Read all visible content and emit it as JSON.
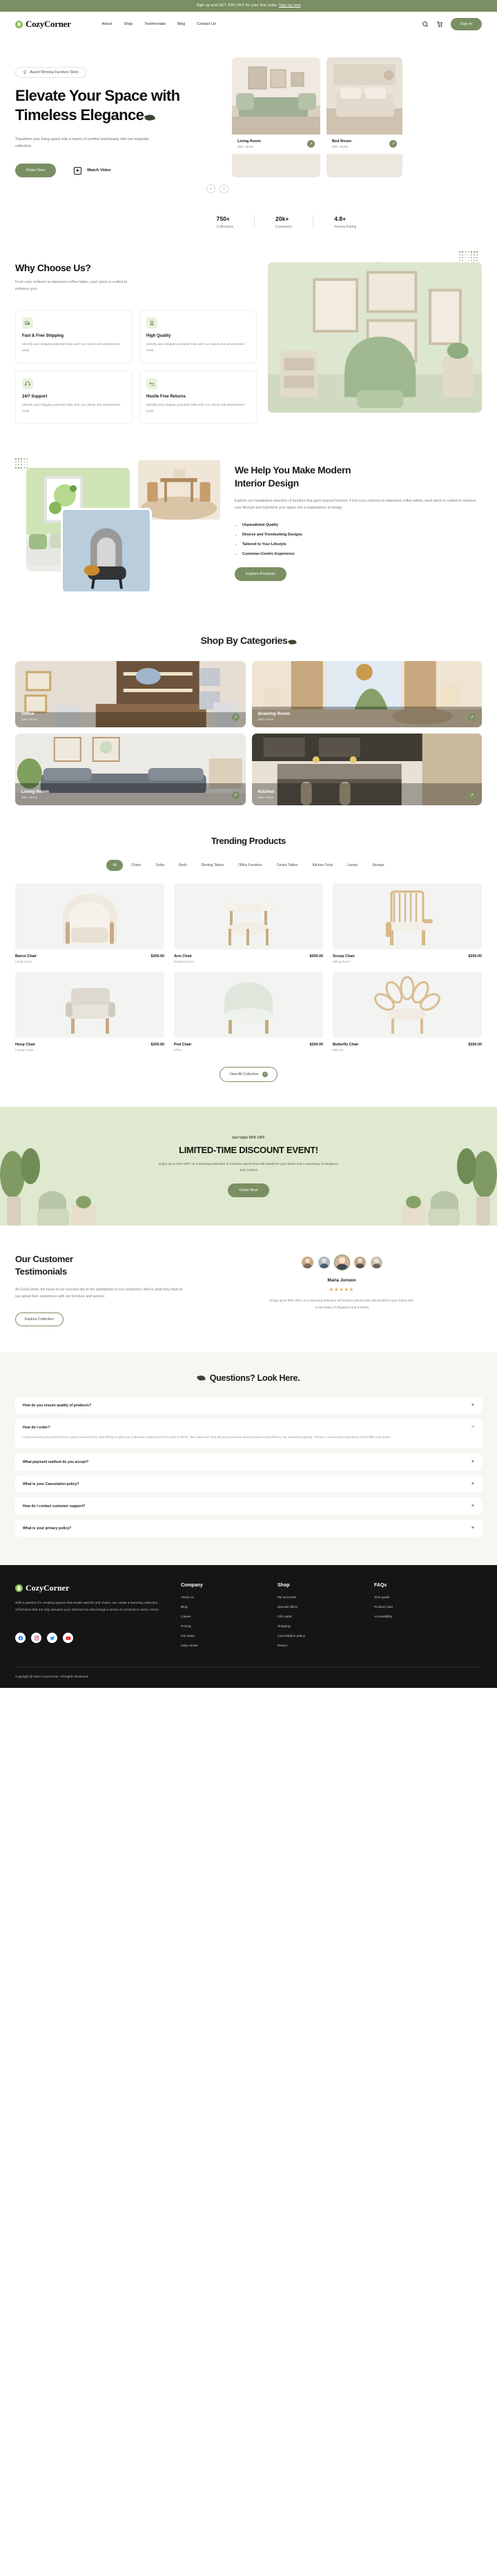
{
  "announcement": {
    "text": "Sign up and GET 20% OFF for your first order.",
    "link": "Sign up now"
  },
  "header": {
    "brand": "CozyCorner",
    "nav": [
      {
        "label": "About"
      },
      {
        "label": "Shop"
      },
      {
        "label": "Testimonials"
      },
      {
        "label": "Blog"
      },
      {
        "label": "Contact Us"
      }
    ],
    "search_icon": "search-icon",
    "cart_icon": "cart-icon",
    "signin_label": "Sign in"
  },
  "hero": {
    "badge": "Award Winning Furniture Store",
    "heading_line1": "Elevate Your Space with",
    "heading_line2": "Timeless Elegance",
    "description": "Transform your living space into a haven of comfort and beauty with our exquisite collection.",
    "primary_cta": "Order Now",
    "secondary_cta": "Watch Video",
    "cards": [
      {
        "name": "Living Room",
        "items": "250+ Items"
      },
      {
        "name": "Bed Room",
        "items": "400+ Items"
      }
    ],
    "prev_icon": "chevron-left-icon",
    "next_icon": "chevron-right-icon"
  },
  "stats": [
    {
      "value": "750+",
      "label": "Collections"
    },
    {
      "value": "20k+",
      "label": "Customers"
    },
    {
      "value": "4.8+",
      "label": "Review Rating"
    }
  ],
  "why": {
    "title": "Why Choose Us?",
    "subtitle": "From cozy recliners to statement coffee tables, each piece is crafted to enhance your.",
    "features": [
      {
        "icon": "truck-icon",
        "title": "Fast & Free Shipping",
        "text": "Identify and mitigate potential risks with our robust risk assessment tools."
      },
      {
        "icon": "medal-icon",
        "title": "High Quality",
        "text": "Identify and mitigate potential risks with our robust risk assessment tools."
      },
      {
        "icon": "headset-icon",
        "title": "24/7 Support",
        "text": "Identify and mitigate potential risks with our robust risk assessment tools."
      },
      {
        "icon": "return-icon",
        "title": "Hustle Free Returns",
        "text": "Identify and mitigate potential risks with our robust risk assessment tools."
      }
    ]
  },
  "interior": {
    "title_line1": "We Help You Make Modern",
    "title_line2": "Interior Design",
    "paragraph": "Explore our handpicked selection of furniture that goes beyond function. From cozy recliners to statement coffee tables, each piece is crafted to enhance your lifestyle and transform your space into a masterpiece of design.",
    "bullets": [
      "Unparalleled Quality",
      "Diverse and Trendsetting Designs",
      "Tailored to Your Lifestyle",
      "Customer-Centric Experience"
    ],
    "cta": "Explore Products"
  },
  "categories": {
    "title": "Shop By Categories",
    "items": [
      {
        "name": "Office",
        "items": "250+ Items"
      },
      {
        "name": "Drawing Room",
        "items": "250+ Items"
      },
      {
        "name": "Living Room",
        "items": "250+ Items"
      },
      {
        "name": "Kitchen",
        "items": "250+ Items"
      }
    ]
  },
  "trending": {
    "title": "Trending Products",
    "filters": [
      "All",
      "Chairs",
      "Sofas",
      "Beds",
      "Dinning Tables",
      "Office Furniture",
      "Centre Tables",
      "Kitchen Tools",
      "Lamps",
      "Storage"
    ],
    "active_filter": "All",
    "products": [
      {
        "name": "Barrol Chair",
        "category": "Living Room",
        "price": "$200.00"
      },
      {
        "name": "Arm Chair",
        "category": "Drawing Room",
        "price": "$200.00"
      },
      {
        "name": "Scoop Chair",
        "category": "Sitting Room",
        "price": "$200.00"
      },
      {
        "name": "Hoop Chair",
        "category": "Lounge Chair",
        "price": "$200.00"
      },
      {
        "name": "Pod Chair",
        "category": "Office",
        "price": "$200.00"
      },
      {
        "name": "Butterfly Chair",
        "category": "Balcony",
        "price": "$200.00"
      }
    ],
    "view_all": "View All Collection"
  },
  "promo": {
    "kicker": "Get Upto 50% OFF",
    "headline": "LIMITED-TIME DISCOUNT EVENT!",
    "text": "Enjoy up to 50% OFF on a stunning selection of furniture pieces that will transform your home into a sanctuary of elegance and comfort",
    "cta": "Order Now"
  },
  "testimonials": {
    "title_line1": "Our Customer",
    "title_line2": "Testimonials",
    "paragraph": "At CozyCorner, the heart of our success lies in the satisfaction of our customers. Here's what they have to say about their experience with our furniture and service.",
    "cta": "Explore Collection",
    "name": "Maria Jonson",
    "rating": "★★★★★",
    "quote": "Enjoy up to 50% OFF on a stunning selection of furniture pieces that will transform your home into a sanctuary of elegance and comfort"
  },
  "faq": {
    "title": "Questions? Look Here.",
    "items": [
      {
        "question": "How do you ensure quality of products?",
        "answer": "",
        "state": "collapsed",
        "toggle": "+"
      },
      {
        "question": "How do I order?",
        "answer": "Understanding your preferences, query requirements, and efforts to give you a fantastic experience from start to finish. We make sure that all your questions about products and delivery are answered quickly. Please a customized experience that fulfills your vision.",
        "state": "expanded",
        "toggle": "−"
      },
      {
        "question": "What payment method do you accept?",
        "answer": "",
        "state": "collapsed",
        "toggle": "+"
      },
      {
        "question": "What is your Cancelation policy?",
        "answer": "",
        "state": "collapsed",
        "toggle": "+"
      },
      {
        "question": "How do I contact customer support?",
        "answer": "",
        "state": "collapsed",
        "toggle": "+"
      },
      {
        "question": "What is your privacy policy?",
        "answer": "",
        "state": "collapsed",
        "toggle": "+"
      }
    ]
  },
  "footer": {
    "brand": "CozyCorner",
    "description": "With a passion for creating spaces that exude warmth and charm, we curate a stunning collection of furniture that not only elevates your interiors but also brings a sense of coziness to every corner.",
    "socials": [
      {
        "name": "facebook-icon",
        "glyph": "f"
      },
      {
        "name": "instagram-icon",
        "glyph": "◎"
      },
      {
        "name": "twitter-icon",
        "glyph": "t"
      },
      {
        "name": "youtube-icon",
        "glyph": "▶"
      }
    ],
    "columns": [
      {
        "heading": "Company",
        "links": [
          "About us",
          "Blog",
          "Career",
          "Pricing",
          "Our team",
          "Help center"
        ]
      },
      {
        "heading": "Shop",
        "links": [
          "My accounts",
          "Special offers",
          "Gift cards",
          "Shipping",
          "Cancellation policy",
          "Return"
        ]
      },
      {
        "heading": "FAQs",
        "links": [
          "Size guide",
          "Product care",
          "Accessibility"
        ]
      }
    ],
    "copyright": "Copyright @ 2024 CozyCorner. All Rights Reserved"
  },
  "colors": {
    "brand_green": "#7a8f63",
    "leaf_green": "#8aba4f",
    "promo_bg": "#dfe9cf",
    "faq_bg": "#f6f7f2",
    "footer_bg": "#151515",
    "star": "#e8a93a"
  }
}
